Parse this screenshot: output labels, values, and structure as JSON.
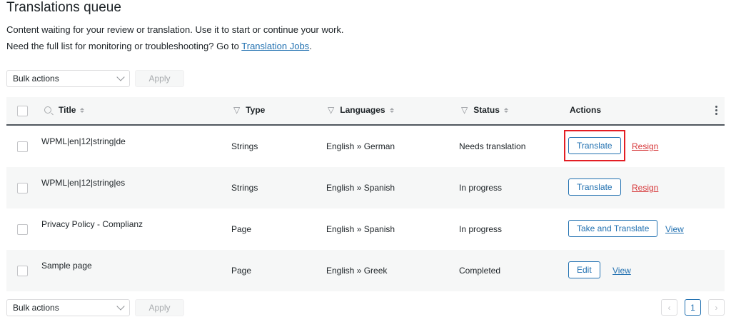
{
  "page": {
    "title": "Translations queue",
    "description": "Content waiting for your review or translation. Use it to start or continue your work.",
    "note_prefix": "Need the full list for monitoring or troubleshooting? Go to ",
    "note_link": "Translation Jobs",
    "note_suffix": "."
  },
  "bulk": {
    "select_label": "Bulk actions",
    "apply_label": "Apply"
  },
  "table": {
    "headers": {
      "title": "Title",
      "type": "Type",
      "languages": "Languages",
      "status": "Status",
      "actions": "Actions"
    },
    "rows": [
      {
        "title": "WPML|en|12|string|de",
        "type": "Strings",
        "languages": "English » German",
        "status": "Needs translation",
        "primary_action": "Translate",
        "secondary_action": "Resign"
      },
      {
        "title": "WPML|en|12|string|es",
        "type": "Strings",
        "languages": "English » Spanish",
        "status": "In progress",
        "primary_action": "Translate",
        "secondary_action": "Resign"
      },
      {
        "title": "Privacy Policy - Complianz",
        "type": "Page",
        "languages": "English » Spanish",
        "status": "In progress",
        "primary_action": "Take and Translate",
        "secondary_action": "View"
      },
      {
        "title": "Sample page",
        "type": "Page",
        "languages": "English » Greek",
        "status": "Completed",
        "primary_action": "Edit",
        "secondary_action": "View"
      }
    ]
  },
  "pagination": {
    "prev": "‹",
    "current": "1",
    "next": "›"
  },
  "colors": {
    "accent": "#2271b1",
    "danger": "#d63638",
    "highlight": "#e31e24"
  }
}
